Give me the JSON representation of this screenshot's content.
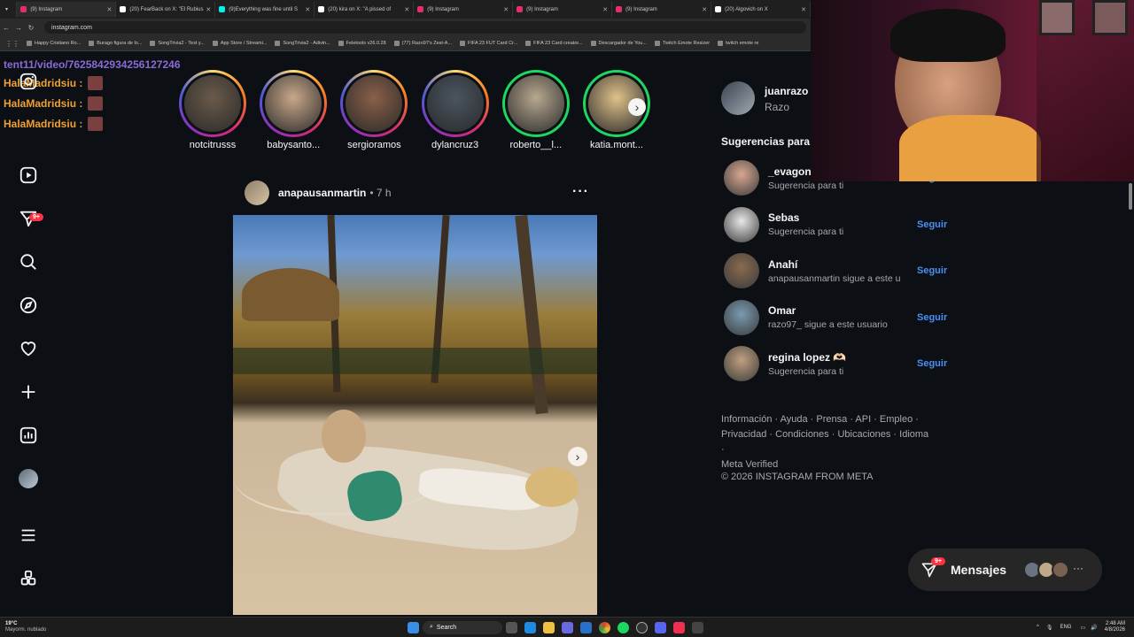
{
  "browser": {
    "tabs": [
      {
        "title": "(9) Instagram",
        "color": "#e1306c"
      },
      {
        "title": "(20) FearBack on X: \"El Rubius",
        "color": "#ffffff"
      },
      {
        "title": "(9)Everything was fine until S",
        "color": "#00f2ea"
      },
      {
        "title": "(20) kira on X: \"A pissed of",
        "color": "#ffffff"
      },
      {
        "title": "(9) Instagram",
        "color": "#e1306c"
      },
      {
        "title": "(9) Instagram",
        "color": "#e1306c"
      },
      {
        "title": "(9) Instagram",
        "color": "#e1306c"
      },
      {
        "title": "(20) Algovich on X",
        "color": "#ffffff"
      }
    ],
    "url": "instagram.com",
    "bookmarks": [
      "Happy Cristiano Ro...",
      "Burago figura de lo...",
      "SongTrivia2 - Test y...",
      "App Store / Streami...",
      "SongTrivia2 - Adivin...",
      "Feletools v26.0.28",
      "(77) Razo97's Zest-A...",
      "FIFA 23 FUT Card Cr...",
      "FIFA 23 Card creator...",
      "Descargador de You...",
      "Twitch Emote Resizer",
      "twitch emote re"
    ]
  },
  "overlay": {
    "link": "tent11/video/7625842934256127246",
    "chat": [
      {
        "user": "HalaMadridsiu :"
      },
      {
        "user": "HalaMadridsiu :"
      },
      {
        "user": "HalaMadridsiu :"
      }
    ]
  },
  "sidebar": {
    "notifications_badge": "9+"
  },
  "stories": [
    {
      "name": "notcitrusss",
      "ring": "new",
      "color": "#6b5a4a"
    },
    {
      "name": "babysanto...",
      "ring": "new",
      "color": "#c9a88a"
    },
    {
      "name": "sergioramos",
      "ring": "new",
      "color": "#8a6048"
    },
    {
      "name": "dylancruz3",
      "ring": "new",
      "color": "#4a5560"
    },
    {
      "name": "roberto__l...",
      "ring": "close",
      "color": "#b8a890"
    },
    {
      "name": "katia.mont...",
      "ring": "close",
      "color": "#e0c28a"
    }
  ],
  "post": {
    "author": "anapausanmartin",
    "time": "• 7 h"
  },
  "account": {
    "username": "juanrazo",
    "fullname": "Razo"
  },
  "suggestions_title": "Sugerencias para ti",
  "suggestions": [
    {
      "name": "_evagonz",
      "sub": "Sugerencia para ti",
      "follow": "Seguir",
      "color": "#d8a890"
    },
    {
      "name": "Sebas",
      "sub": "Sugerencia para ti",
      "follow": "Seguir",
      "color": "#e8e8e8"
    },
    {
      "name": "Anahí",
      "sub": "anapausanmartin sigue a este u",
      "follow": "Seguir",
      "color": "#8a6a50"
    },
    {
      "name": "Omar",
      "sub": "razo97_ sigue a este usuario",
      "follow": "Seguir",
      "color": "#7a9ab0"
    },
    {
      "name": "regina lopez 🫶🏻",
      "sub": "Sugerencia para ti",
      "follow": "Seguir",
      "color": "#c0a080"
    }
  ],
  "footer": {
    "links_line1": "Información · Ayuda · Prensa · API · Empleo ·",
    "links_line2": "Privacidad · Condiciones · Ubicaciones · Idioma ·",
    "links_line3": "Meta Verified",
    "copyright": "© 2026 INSTAGRAM FROM META"
  },
  "messages": {
    "label": "Mensajes",
    "badge": "9+"
  },
  "taskbar": {
    "weather_temp": "19°C",
    "weather_desc": "Mayorm. nublado",
    "search": "Search",
    "lang": "ENG",
    "time": "2:48 AM",
    "date": "4/8/2026"
  }
}
